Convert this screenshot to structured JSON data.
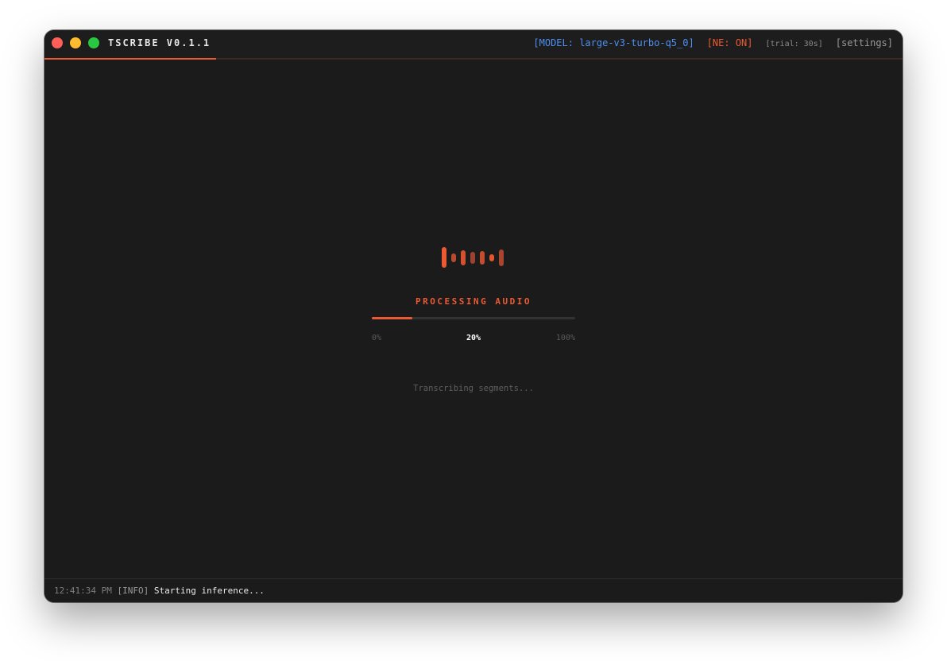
{
  "window": {
    "app_title": "TSCRIBE V0.1.1",
    "model_label": "[MODEL: large-v3-turbo-q5_0]",
    "ne_label": "[NE: ON]",
    "trial_label": "[trial: 30s]",
    "settings_label": "[settings]"
  },
  "colors": {
    "accent": "#ec5a33",
    "model_blue": "#4e8ff0",
    "background": "#1b1b1b"
  },
  "processing": {
    "title": "PROCESSING AUDIO",
    "progress_fraction": 0.2,
    "min_label": "0%",
    "current_label": "20%",
    "max_label": "100%",
    "status": "Transcribing segments..."
  },
  "footer": {
    "time": "12:41:34 PM",
    "level": "[INFO]",
    "message": "Starting inference..."
  }
}
